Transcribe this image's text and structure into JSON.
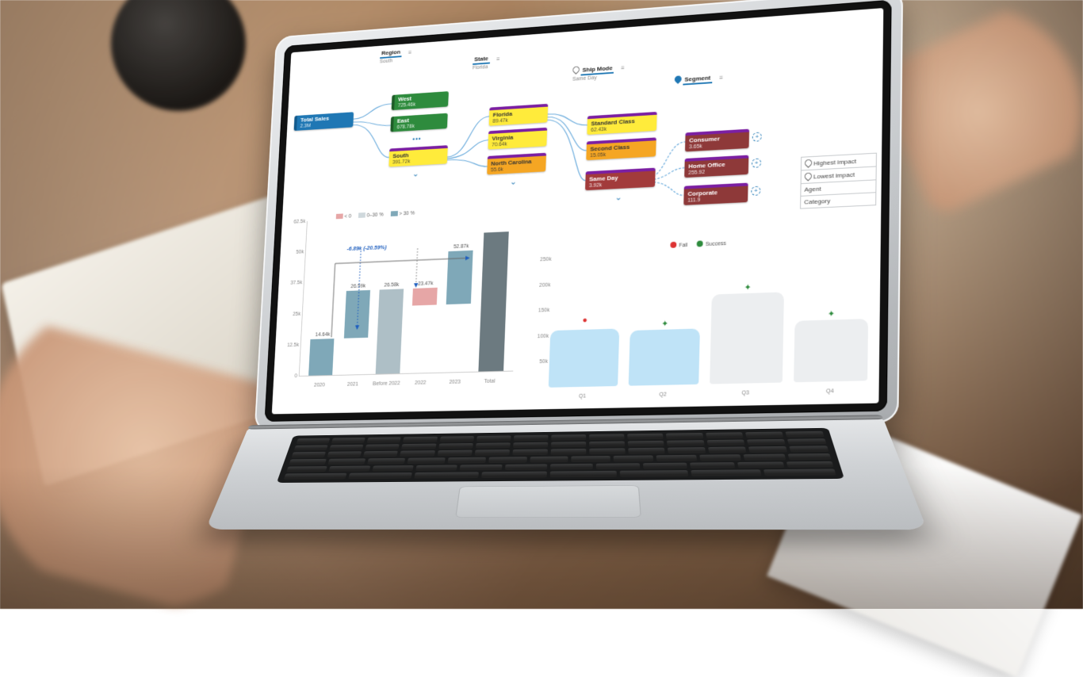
{
  "breadcrumbs": {
    "region": {
      "label": "Region",
      "value": "South"
    },
    "state": {
      "label": "State",
      "value": "Florida"
    },
    "shipmode": {
      "label": "Ship Mode",
      "value": "Same Day"
    },
    "segment": {
      "label": "Segment",
      "value": ""
    }
  },
  "sankey": {
    "root": {
      "title": "Total Sales",
      "value": "2.3M"
    },
    "region": [
      {
        "title": "West",
        "value": "725.46k",
        "color": "green"
      },
      {
        "title": "East",
        "value": "678.78k",
        "color": "green"
      },
      {
        "title": "South",
        "value": "391.72k",
        "color": "yellow",
        "selected": true
      }
    ],
    "state": [
      {
        "title": "Florida",
        "value": "89.47k",
        "color": "yellow",
        "selected": true
      },
      {
        "title": "Virginia",
        "value": "70.64k",
        "color": "yellow"
      },
      {
        "title": "North Carolina",
        "value": "55.6k",
        "color": "orange"
      }
    ],
    "shipmode": [
      {
        "title": "Standard Class",
        "value": "62.43k",
        "color": "yellow"
      },
      {
        "title": "Second Class",
        "value": "15.05k",
        "color": "orange"
      },
      {
        "title": "Same Day",
        "value": "3.92k",
        "color": "red",
        "selected": true
      }
    ],
    "segment": [
      {
        "title": "Consumer",
        "value": "3.65k",
        "color": "maroon"
      },
      {
        "title": "Home Office",
        "value": "255.92",
        "color": "maroon"
      },
      {
        "title": "Corporate",
        "value": "111.9",
        "color": "maroon"
      }
    ],
    "menu": [
      "Highest impact",
      "Lowest impact",
      "Agent",
      "Category"
    ]
  },
  "waterfall": {
    "legend": [
      "< 0",
      "0–30 %",
      "> 30 %"
    ],
    "annotation": "-6.89k (-20.59%)",
    "annotation_from": "2021",
    "annotation_to": "2022",
    "ymax": 62500
  },
  "quarterly": {
    "legend": {
      "fail": "Fail",
      "success": "Success"
    }
  },
  "chart_data": [
    {
      "type": "bar",
      "name": "waterfall",
      "categories": [
        "2020",
        "2021",
        "Before 2022",
        "2022",
        "2023",
        "Total"
      ],
      "values": [
        14640,
        18800,
        33440,
        13270,
        21000,
        54440
      ],
      "positives": [
        14640,
        18800,
        null,
        null,
        21000,
        null
      ],
      "negatives": [
        null,
        null,
        null,
        -6890,
        null,
        null
      ],
      "labels": [
        "14.64k",
        "26.59k",
        "26.58k",
        "23.47k",
        "52.87k",
        ""
      ],
      "ylim": [
        0,
        62500
      ],
      "yticks": [
        0,
        12500,
        25000,
        37500,
        50000,
        62500
      ],
      "ytick_labels": [
        "0",
        "12.5k",
        "25k",
        "37.5k",
        "50k",
        "62.5k"
      ]
    },
    {
      "type": "bar",
      "name": "quarterly",
      "categories": [
        "Q1",
        "Q2",
        "Q3",
        "Q4"
      ],
      "values": [
        110,
        105,
        170,
        115
      ],
      "status": [
        "fail",
        "success",
        "success",
        "success"
      ],
      "ylim": [
        0,
        250
      ],
      "yticks": [
        50,
        100,
        150,
        200,
        250
      ],
      "ytick_labels": [
        "50k",
        "100k",
        "150k",
        "200k",
        "250k"
      ]
    }
  ]
}
